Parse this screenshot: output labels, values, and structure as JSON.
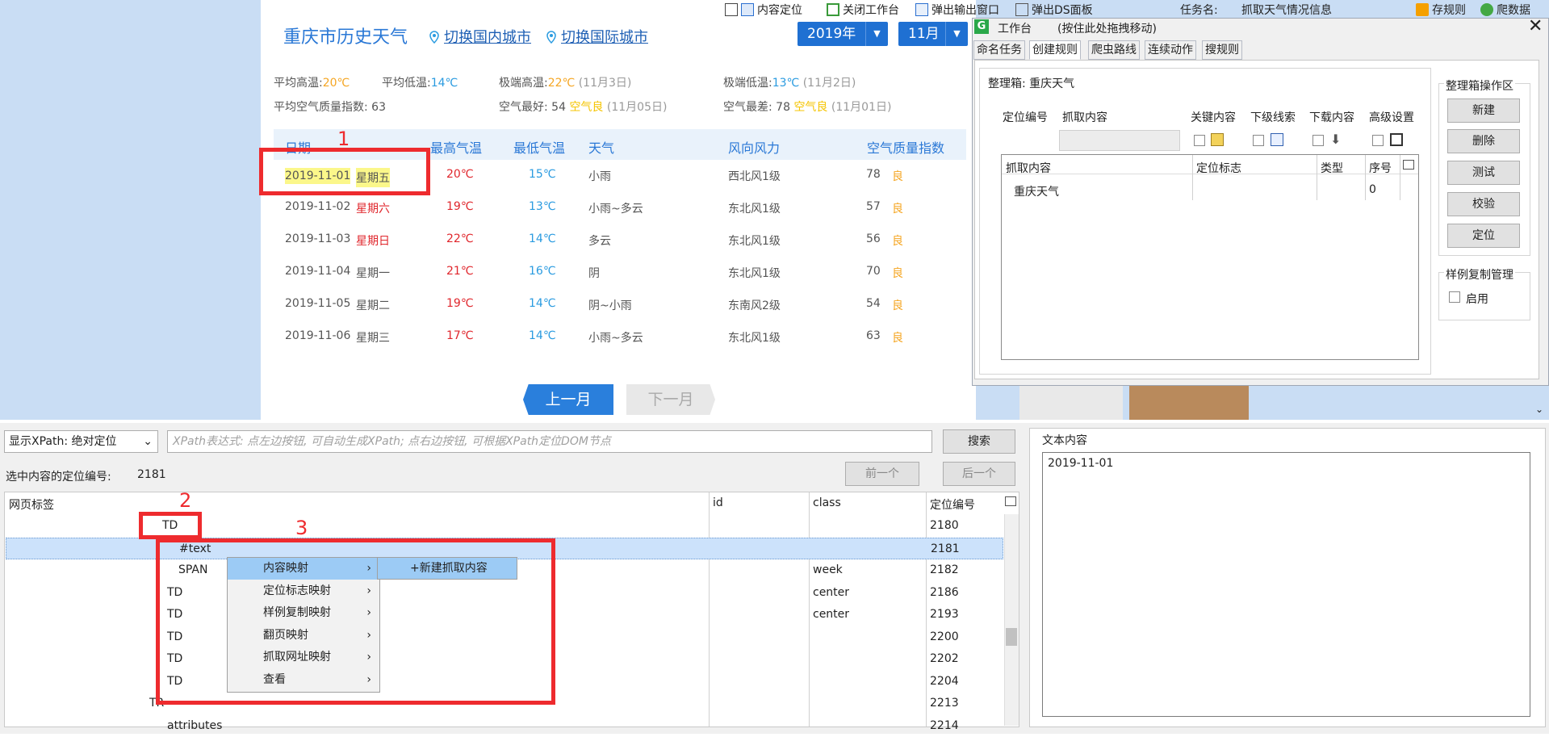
{
  "toolbar": {
    "locate_label": "内容定位",
    "close_workbench": "关闭工作台",
    "popup_output": "弹出输出窗口",
    "popup_ds": "弹出DS面板",
    "task_label": "任务名:",
    "task_name": "抓取天气情况信息",
    "save_rule": "存规则",
    "crawl_data": "爬数据"
  },
  "webpage": {
    "title": "重庆市历史天气",
    "switch_domestic": "切换国内城市",
    "switch_intl": "切换国际城市",
    "year": "2019年",
    "month": "11月",
    "stats": {
      "avg_high_label": "平均高温:",
      "avg_high": "20℃",
      "avg_low_label": "平均低温:",
      "avg_low": "14℃",
      "ext_high_label": "极端高温:",
      "ext_high": "22℃",
      "ext_high_date": "(11月3日)",
      "ext_low_label": "极端低温:",
      "ext_low": "13℃",
      "ext_low_date": "(11月2日)",
      "aqi_label": "平均空气质量指数: 63",
      "best_label": "空气最好: 54",
      "best_q": "空气良",
      "best_date": "(11月05日)",
      "worst_label": "空气最差: 78",
      "worst_q": "空气良",
      "worst_date": "(11月01日)"
    },
    "headers": [
      "日期",
      "最高气温",
      "最低气温",
      "天气",
      "风向风力",
      "空气质量指数"
    ],
    "rows": [
      {
        "date": "2019-11-01",
        "week": "星期五",
        "hi": "20℃",
        "lo": "15℃",
        "weather": "小雨",
        "wind": "西北风1级",
        "aqi": "78",
        "q": "良"
      },
      {
        "date": "2019-11-02",
        "week": "星期六",
        "hi": "19℃",
        "lo": "13℃",
        "weather": "小雨~多云",
        "wind": "东北风1级",
        "aqi": "57",
        "q": "良"
      },
      {
        "date": "2019-11-03",
        "week": "星期日",
        "hi": "22℃",
        "lo": "14℃",
        "weather": "多云",
        "wind": "东北风1级",
        "aqi": "56",
        "q": "良"
      },
      {
        "date": "2019-11-04",
        "week": "星期一",
        "hi": "21℃",
        "lo": "16℃",
        "weather": "阴",
        "wind": "东北风1级",
        "aqi": "70",
        "q": "良"
      },
      {
        "date": "2019-11-05",
        "week": "星期二",
        "hi": "19℃",
        "lo": "14℃",
        "weather": "阴~小雨",
        "wind": "东南风2级",
        "aqi": "54",
        "q": "良"
      },
      {
        "date": "2019-11-06",
        "week": "星期三",
        "hi": "17℃",
        "lo": "14℃",
        "weather": "小雨~多云",
        "wind": "东北风1级",
        "aqi": "63",
        "q": "良"
      }
    ],
    "prev_month": "上一月",
    "next_month": "下一月"
  },
  "annotations": {
    "n1": "1",
    "n2": "2",
    "n3": "3"
  },
  "workbench": {
    "title": "工作台",
    "drag_hint": "(按住此处拖拽移动)",
    "tabs": [
      "命名任务",
      "创建规则",
      "爬虫路线",
      "连续动作",
      "搜规则"
    ],
    "box_label": "整理箱: 重庆天气",
    "cols": {
      "locate_no": "定位编号",
      "grab": "抓取内容",
      "key": "关键内容",
      "sub": "下级线索",
      "download": "下载内容",
      "adv": "高级设置"
    },
    "tbl_headers": [
      "抓取内容",
      "定位标志",
      "类型",
      "序号"
    ],
    "tbl_row": {
      "content": "重庆天气",
      "seq": "0"
    },
    "ops_title": "整理箱操作区",
    "ops": [
      "新建",
      "删除",
      "测试",
      "校验",
      "定位"
    ],
    "copy_title": "样例复制管理",
    "copy_enable": "启用"
  },
  "bottom": {
    "xpath_mode": "显示XPath: 绝对定位",
    "xpath_placeholder": "XPath表达式: 点左边按钮, 可自动生成XPath; 点右边按钮, 可根据XPath定位DOM节点",
    "search": "搜索",
    "sel_label": "选中内容的定位编号:",
    "sel_value": "2181",
    "prev": "前一个",
    "next": "后一个",
    "grid_headers": [
      "网页标签",
      "id",
      "class",
      "定位编号"
    ],
    "rows": [
      {
        "tag": "TD",
        "cls": "",
        "no": "2180"
      },
      {
        "tag": "#text",
        "cls": "",
        "no": "2181"
      },
      {
        "tag": "SPAN",
        "cls": "week",
        "no": "2182"
      },
      {
        "tag": "TD",
        "cls": "center",
        "no": "2186"
      },
      {
        "tag": "TD",
        "cls": "center",
        "no": "2193"
      },
      {
        "tag": "TD",
        "cls": "",
        "no": "2200"
      },
      {
        "tag": "TD",
        "cls": "",
        "no": "2202"
      },
      {
        "tag": "TD",
        "cls": "",
        "no": "2204"
      },
      {
        "tag": "TR",
        "cls": "",
        "no": "2213"
      },
      {
        "tag": "attributes",
        "cls": "",
        "no": "2214"
      }
    ],
    "text_title": "文本内容",
    "text_value": "2019-11-01",
    "menu": [
      "内容映射",
      "定位标志映射",
      "样例复制映射",
      "翻页映射",
      "抓取网址映射",
      "查看"
    ],
    "submenu": "+新建抓取内容"
  },
  "colors": {
    "accent": "#1f70d2",
    "annot": "#ee2b2e"
  }
}
